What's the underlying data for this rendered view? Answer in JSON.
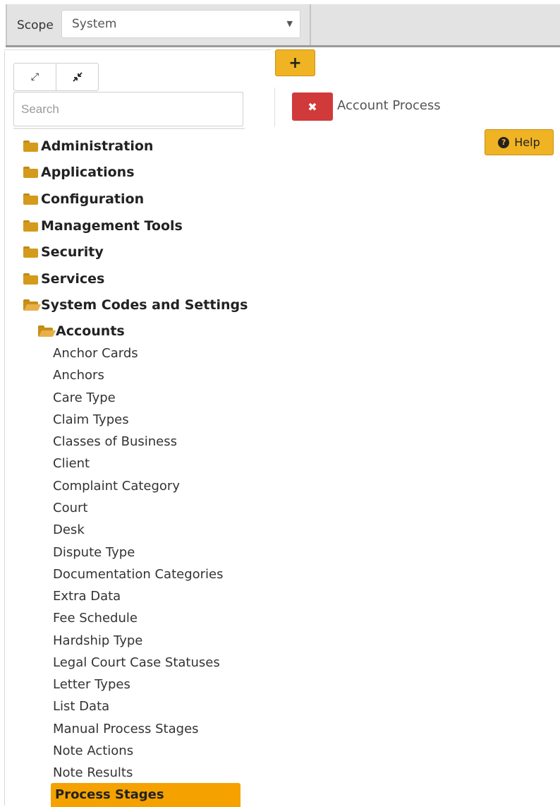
{
  "header": {
    "scope_label": "Scope",
    "scope_value": "System"
  },
  "sidebar": {
    "expand_icon": "expand-arrows-icon",
    "collapse_icon": "collapse-arrows-icon",
    "search_placeholder": "Search",
    "folders": [
      {
        "label": "Administration",
        "open": false
      },
      {
        "label": "Applications",
        "open": false
      },
      {
        "label": "Configuration",
        "open": false
      },
      {
        "label": "Management Tools",
        "open": false
      },
      {
        "label": "Security",
        "open": false
      },
      {
        "label": "Services",
        "open": false
      },
      {
        "label": "System Codes and Settings",
        "open": true
      }
    ],
    "subfolder": {
      "label": "Accounts",
      "open": true
    },
    "items": [
      "Anchor Cards",
      "Anchors",
      "Care Type",
      "Claim Types",
      "Classes of Business",
      "Client",
      "Complaint Category",
      "Court",
      "Desk",
      "Dispute Type",
      "Documentation Categories",
      "Extra Data",
      "Fee Schedule",
      "Hardship Type",
      "Legal Court Case Statuses",
      "Letter Types",
      "List Data",
      "Manual Process Stages",
      "Note Actions",
      "Note Results",
      "Process Stages"
    ],
    "selected_item": "Process Stages"
  },
  "main": {
    "add_label": "+",
    "tab_close_label": "✖",
    "tab_title": "Account Process",
    "help_label": "Help",
    "help_icon_glyph": "?"
  },
  "colors": {
    "accent": "#f0b323",
    "selected": "#f5a200",
    "danger": "#d03a3a",
    "folder": "#d49a1c"
  }
}
